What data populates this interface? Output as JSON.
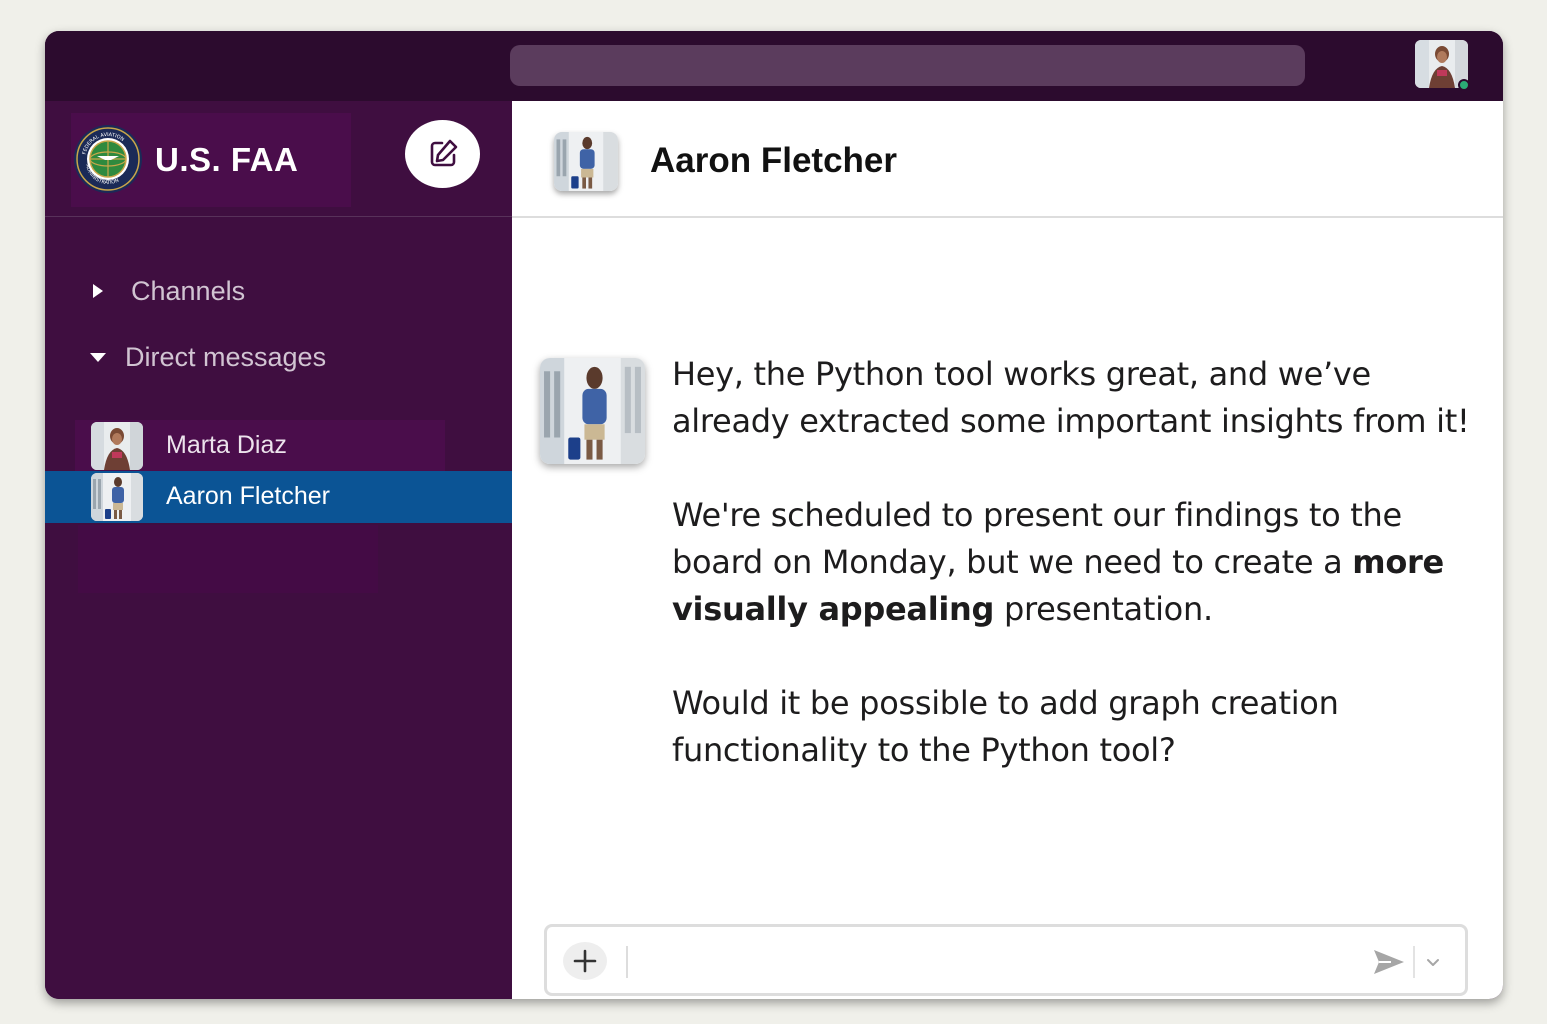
{
  "workspace": {
    "name": "U.S. FAA",
    "logo_icon": "faa-seal-icon",
    "seal_text": [
      "FEDERAL AVIATION",
      "ADMINISTRATION"
    ]
  },
  "sidebar": {
    "sections": [
      {
        "label": "Channels",
        "expanded": false
      },
      {
        "label": "Direct messages",
        "expanded": true
      }
    ],
    "direct_messages": [
      {
        "name": "Marta Diaz",
        "selected": false
      },
      {
        "name": "Aaron Fletcher",
        "selected": true
      }
    ]
  },
  "chat": {
    "title": "Aaron Fletcher",
    "message": {
      "paragraph_1": "Hey, the Python tool works great, and we’ve already extracted some important insights from it!",
      "paragraph_2_before": "We're scheduled to present our findings to the board on Monday, but we need to create a ",
      "paragraph_2_bold": "more visually appealing",
      "paragraph_2_after": " presentation.",
      "paragraph_3": "Would it be possible to add graph creation functionality to the Python tool?"
    }
  },
  "composer": {
    "value": "",
    "placeholder": ""
  },
  "colors": {
    "topbar": "#2c0b2e",
    "sidebar": "#3f0e40",
    "selected": "#0b5495",
    "search": "#5b3c5d",
    "status_online": "#2bac76"
  }
}
